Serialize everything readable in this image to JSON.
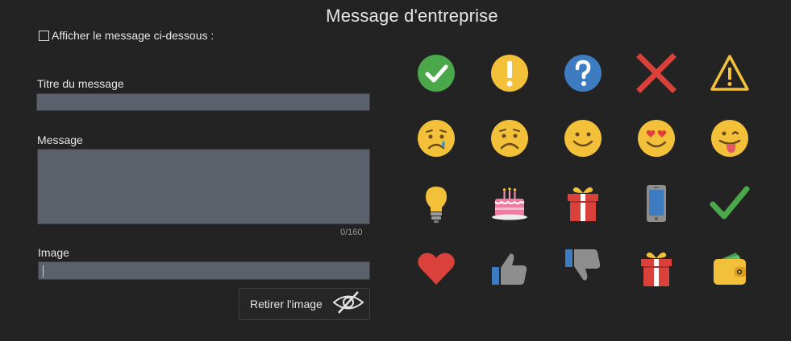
{
  "page": {
    "title": "Message d'entreprise"
  },
  "form": {
    "show_checkbox_label": "Afficher le message ci-dessous :",
    "title_label": "Titre du message",
    "title_value": "",
    "message_label": "Message",
    "message_value": "",
    "message_counter": "0/160",
    "image_label": "Image",
    "image_value": "",
    "remove_image_label": "Retirer l'image"
  },
  "emojis": [
    "check-circle-icon",
    "exclamation-circle-icon",
    "question-circle-icon",
    "cross-icon",
    "warning-icon",
    "crying-face-icon",
    "sad-face-icon",
    "smile-face-icon",
    "heart-eyes-face-icon",
    "tongue-face-icon",
    "lightbulb-icon",
    "birthday-cake-icon",
    "gift-icon",
    "smartphone-icon",
    "checkmark-icon",
    "heart-icon",
    "thumbs-up-icon",
    "thumbs-down-icon",
    "gift-icon",
    "wallet-icon"
  ],
  "colors": {
    "background": "#232323",
    "input_fill": "#5b616b",
    "emoji_yellow": "#f2c039",
    "green": "#4aa84a",
    "blue": "#3d7cc0",
    "red": "#d9413a"
  }
}
